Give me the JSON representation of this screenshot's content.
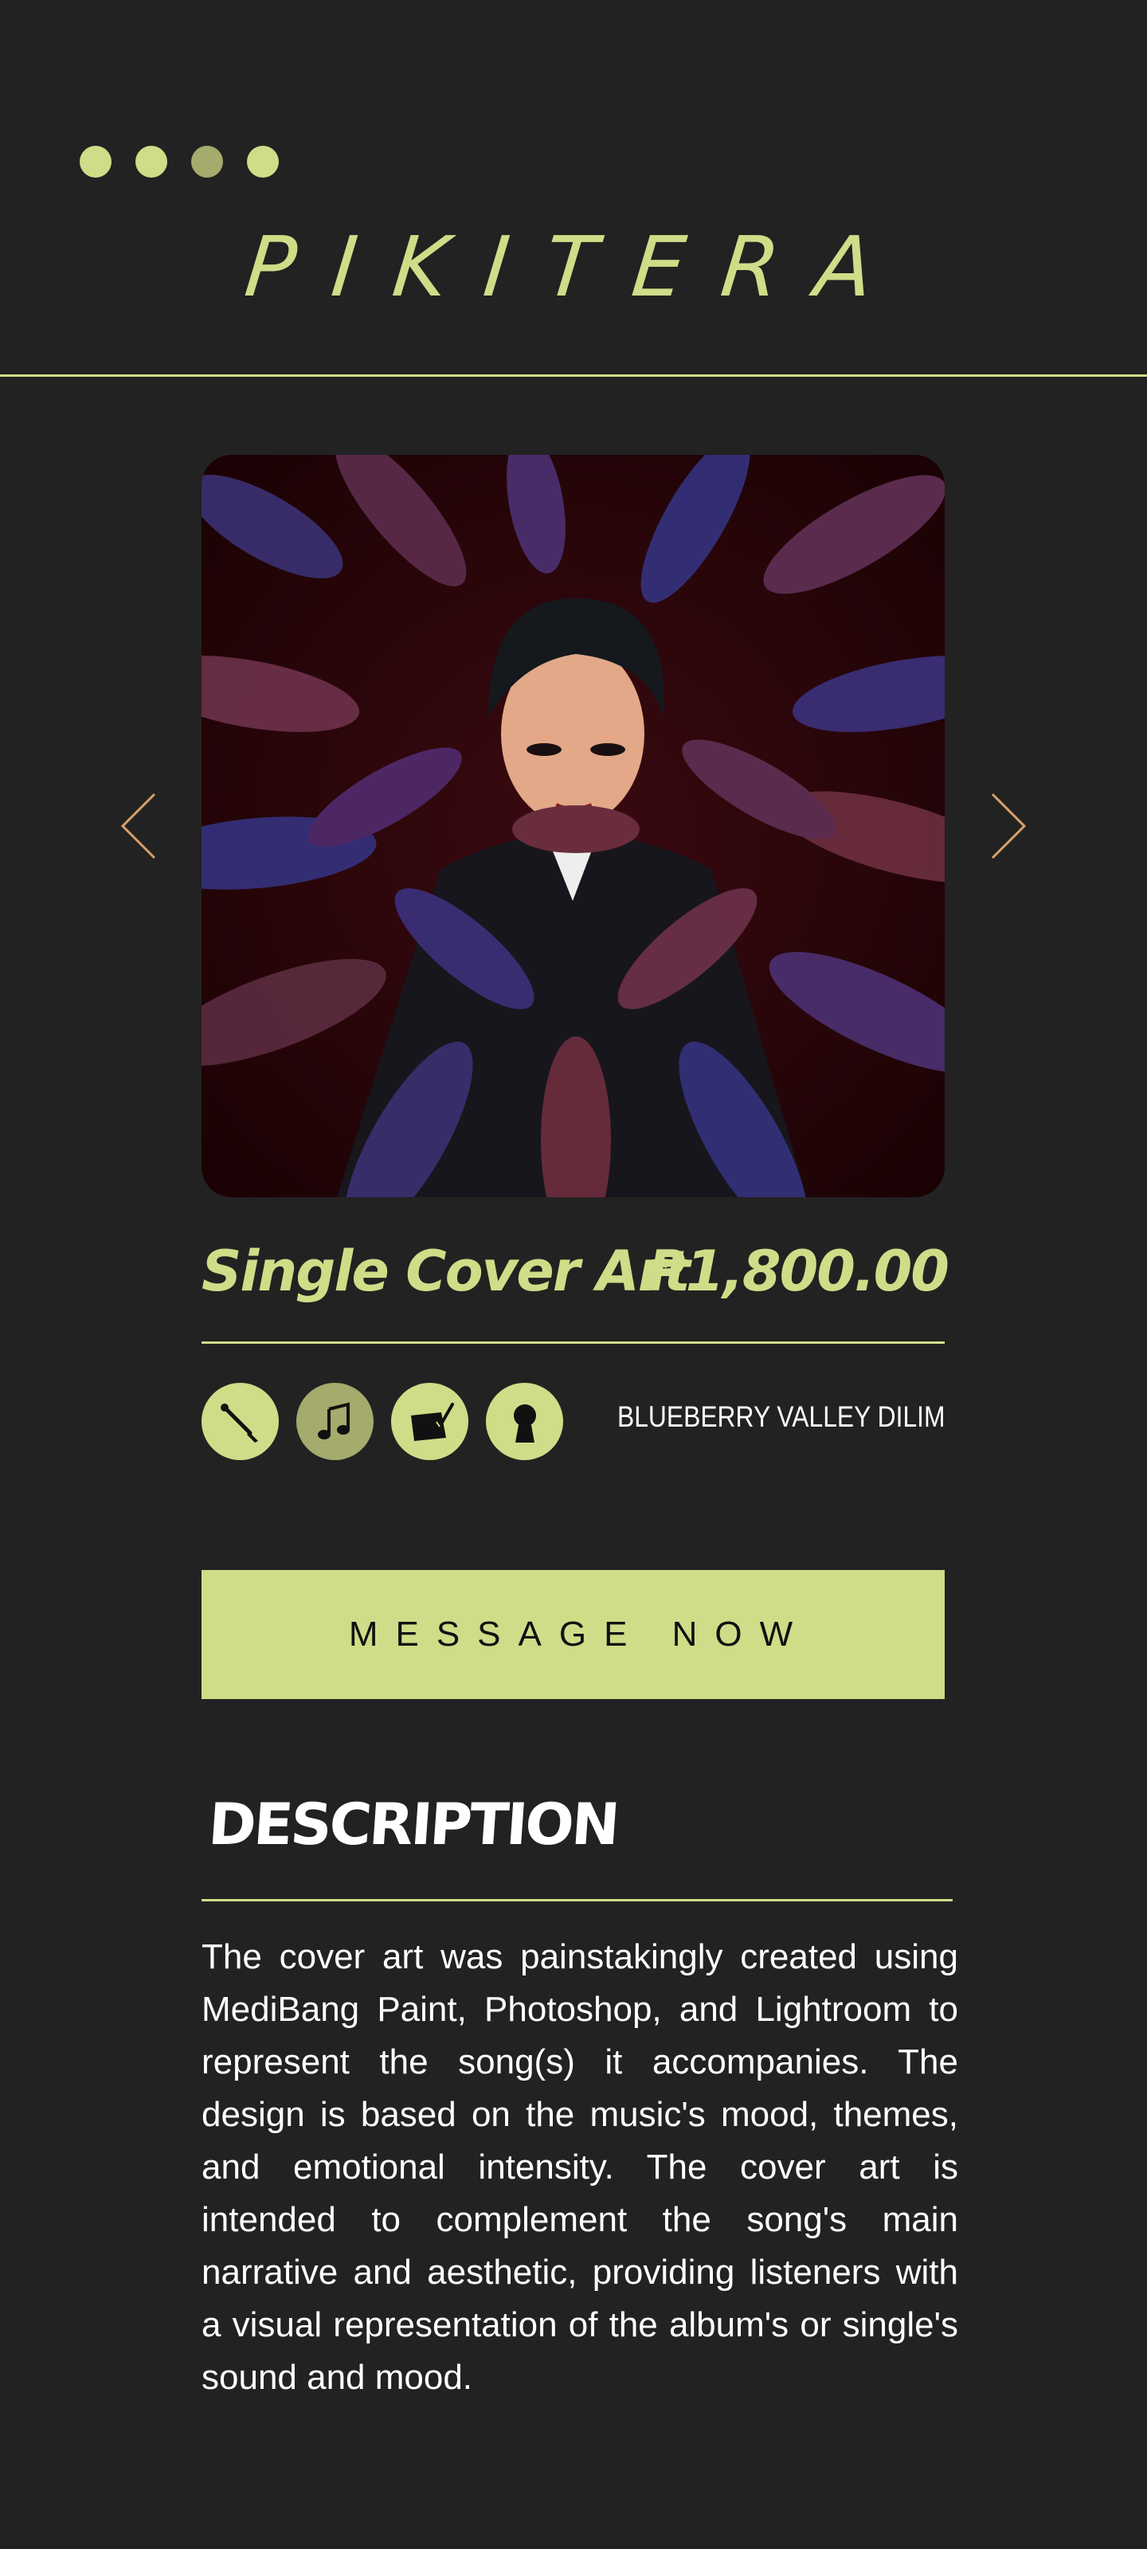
{
  "header": {
    "logo_text": "PIKITERA",
    "carousel_dot_states": [
      "inactive",
      "inactive",
      "active",
      "inactive"
    ]
  },
  "gallery": {
    "artwork_alt": "Single Cover Art",
    "prev_icon": "chevron-left-icon",
    "next_icon": "chevron-right-icon"
  },
  "product": {
    "title": "Single Cover Art",
    "price": "₱1,800.00",
    "location": "BLUEBERRY VALLEY DILIM",
    "category_icons": [
      "paintbrush-icon",
      "music-note-icon",
      "drawing-tablet-icon",
      "avatar-icon"
    ]
  },
  "actions": {
    "message_label": "MESSAGE NOW"
  },
  "description": {
    "heading": "DESCRIPTION",
    "body": "The cover art was painstakingly created using MediBang Paint, Photoshop, and Lightroom to represent the song(s) it accompanies. The design is based on the music's mood, themes, and emotional intensity. The cover art is intended to complement the song's main narrative and aesthetic, providing listeners with a visual representation of the album's or single's sound and mood."
  },
  "colors": {
    "background": "#222222",
    "accent": "#cfdd88",
    "accent_dim": "#a4ab6c",
    "arrow": "#d8a06a",
    "text": "#ffffff"
  }
}
